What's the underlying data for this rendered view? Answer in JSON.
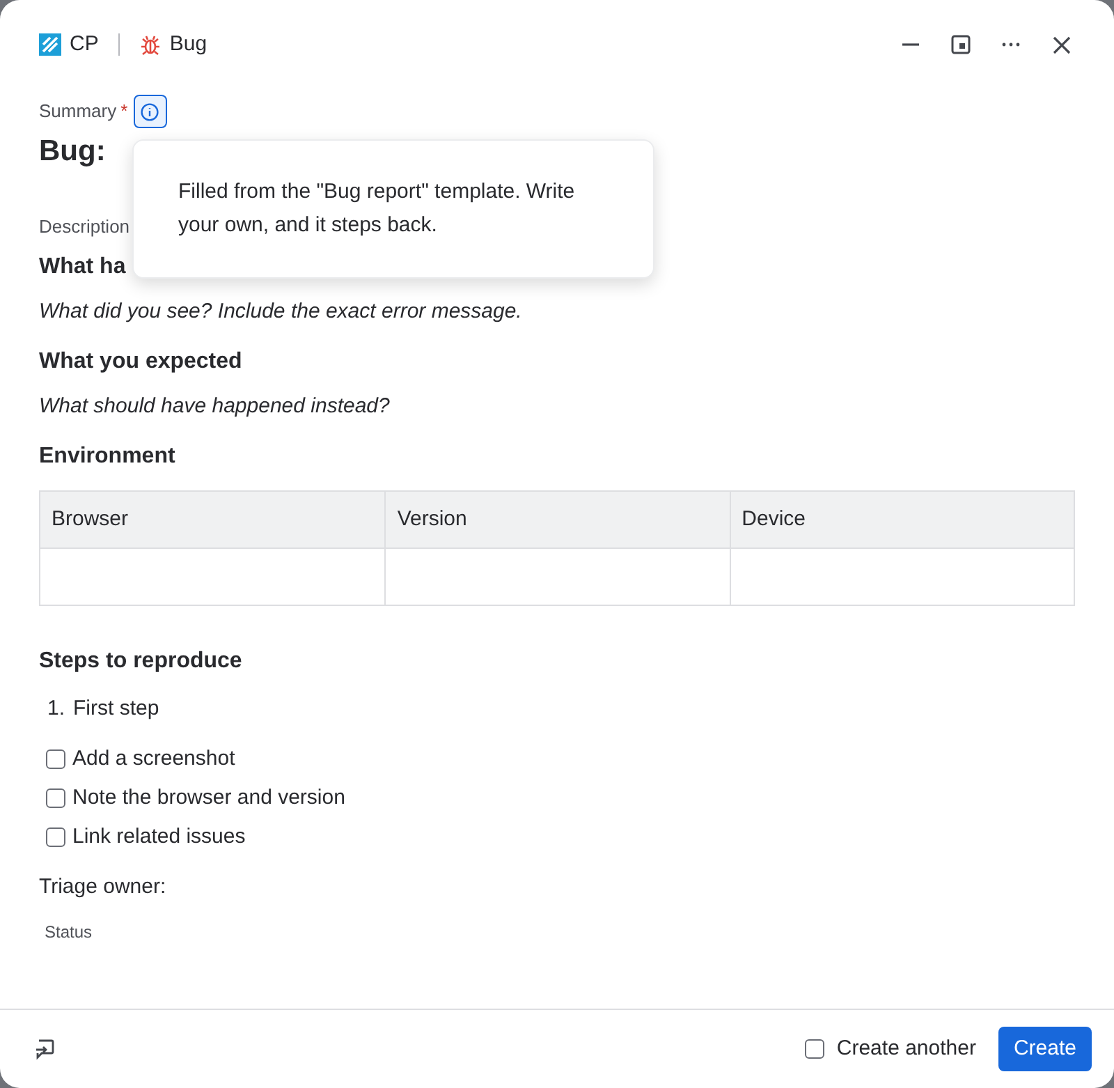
{
  "header": {
    "project": "CP",
    "issue_type": "Bug"
  },
  "summary": {
    "label": "Summary",
    "required_mark": "*",
    "value": "Bug:",
    "info_active": true
  },
  "tooltip": {
    "text": "Filled from the \"Bug report\" template. Write your own, and it steps back."
  },
  "description": {
    "label": "Description",
    "blocks": [
      {
        "kind": "heading",
        "text": "What ha"
      },
      {
        "kind": "hint",
        "text": "What did you see? Include the exact error message."
      },
      {
        "kind": "heading",
        "text": "What you expected"
      },
      {
        "kind": "hint",
        "text": "What should have happened instead?"
      },
      {
        "kind": "heading",
        "text": "Environment"
      },
      {
        "kind": "table",
        "columns": [
          "Browser",
          "Version",
          "Device"
        ]
      },
      {
        "kind": "heading",
        "text": "Steps to reproduce"
      },
      {
        "kind": "numbered",
        "items": [
          {
            "marker": "1.",
            "text": "First step"
          }
        ]
      },
      {
        "kind": "checklist",
        "items": [
          {
            "text": "Add a screenshot",
            "checked": false
          },
          {
            "text": "Note the browser and version",
            "checked": false
          },
          {
            "text": "Link related issues",
            "checked": false
          }
        ]
      },
      {
        "kind": "paragraph",
        "text": "Triage owner:"
      }
    ]
  },
  "status": {
    "label": "Status"
  },
  "footer": {
    "create_another": {
      "label": "Create another",
      "checked": false
    },
    "create_button": "Create"
  }
}
